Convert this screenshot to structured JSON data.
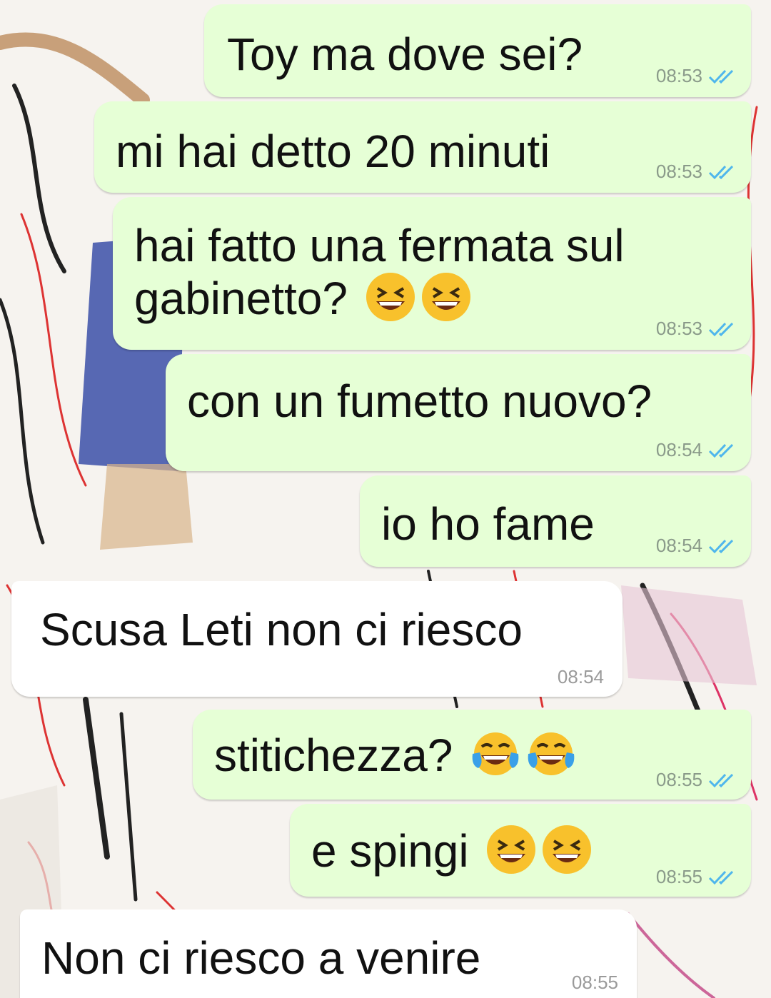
{
  "chat": {
    "messages": [
      {
        "direction": "outgoing",
        "text": "Toy ma dove sei?",
        "time": "08:53",
        "status": "read"
      },
      {
        "direction": "outgoing",
        "text": "mi hai detto 20 minuti",
        "time": "08:53",
        "status": "read"
      },
      {
        "direction": "outgoing",
        "text_line1": "hai fatto una fermata sul",
        "text_line2": "gabinetto?",
        "emoji": [
          "grinning-squinting",
          "grinning-squinting"
        ],
        "time": "08:53",
        "status": "read"
      },
      {
        "direction": "outgoing",
        "text": "con un fumetto nuovo?",
        "time": "08:54",
        "status": "read"
      },
      {
        "direction": "outgoing",
        "text": "io ho fame",
        "time": "08:54",
        "status": "read"
      },
      {
        "direction": "incoming",
        "text": "Scusa Leti non ci riesco",
        "time": "08:54"
      },
      {
        "direction": "outgoing",
        "text": "stitichezza?",
        "emoji": [
          "tears-of-joy",
          "tears-of-joy"
        ],
        "time": "08:55",
        "status": "read"
      },
      {
        "direction": "outgoing",
        "text": "e spingi",
        "emoji": [
          "grinning-squinting",
          "grinning-squinting"
        ],
        "time": "08:55",
        "status": "read"
      },
      {
        "direction": "incoming",
        "text": "Non ci riesco a venire",
        "time": "08:55"
      }
    ]
  },
  "colors": {
    "outgoing_bubble": "#e6ffd6",
    "incoming_bubble": "#ffffff",
    "read_ticks": "#4fb6ec"
  }
}
